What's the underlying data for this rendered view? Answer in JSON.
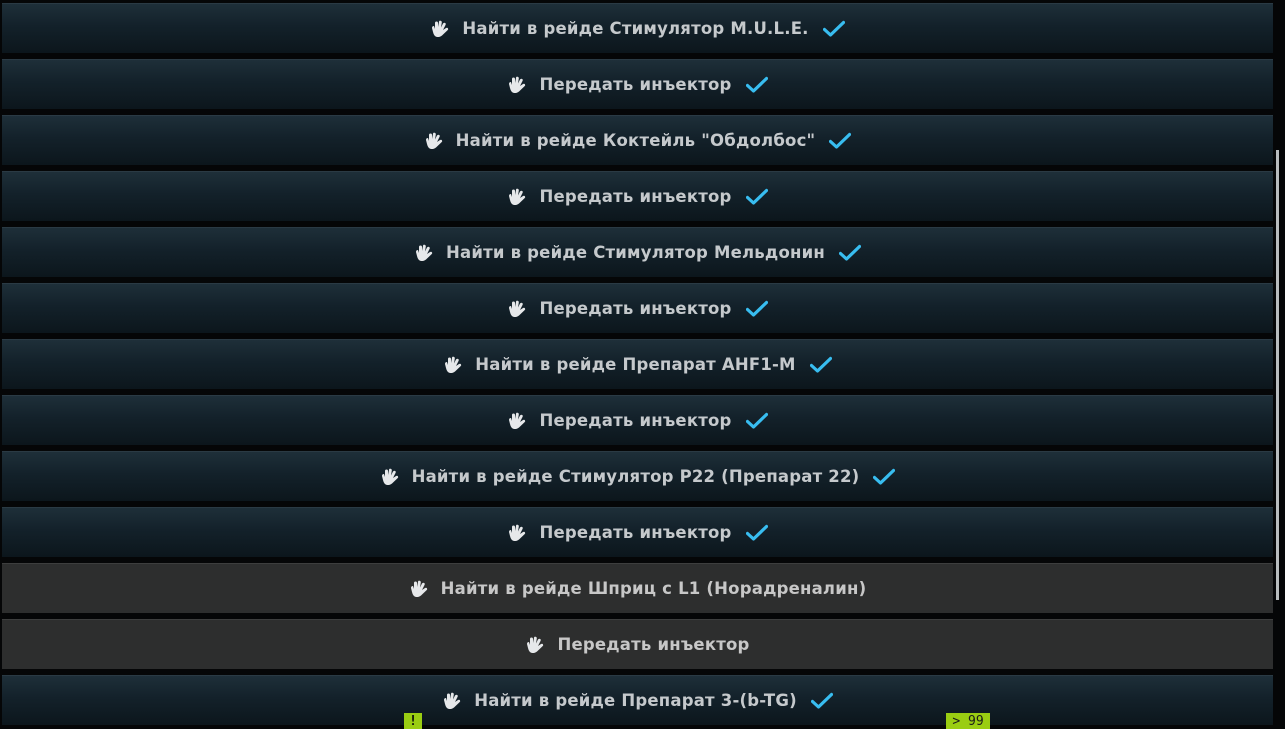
{
  "colors": {
    "done_row": "#13212a",
    "pending_row": "#2d2e2e",
    "check": "#38bdf0",
    "badge": "#9acd12"
  },
  "objectives": [
    {
      "label": "Найти в рейде Стимулятор M.U.L.E.",
      "icon": "hand-icon",
      "completed": true
    },
    {
      "label": "Передать инъектор",
      "icon": "hand-icon",
      "completed": true
    },
    {
      "label": "Найти в рейде Коктейль \"Обдолбос\"",
      "icon": "hand-icon",
      "completed": true
    },
    {
      "label": "Передать инъектор",
      "icon": "hand-icon",
      "completed": true
    },
    {
      "label": "Найти в рейде Стимулятор Мельдонин",
      "icon": "hand-icon",
      "completed": true
    },
    {
      "label": "Передать инъектор",
      "icon": "hand-icon",
      "completed": true
    },
    {
      "label": "Найти в рейде Препарат AHF1-M",
      "icon": "hand-icon",
      "completed": true
    },
    {
      "label": "Передать инъектор",
      "icon": "hand-icon",
      "completed": true
    },
    {
      "label": "Найти в рейде Стимулятор P22 (Препарат 22)",
      "icon": "hand-icon",
      "completed": true
    },
    {
      "label": "Передать инъектор",
      "icon": "hand-icon",
      "completed": true
    },
    {
      "label": "Найти в рейде Шприц с L1 (Норадреналин)",
      "icon": "hand-icon",
      "completed": false
    },
    {
      "label": "Передать инъектор",
      "icon": "hand-icon",
      "completed": false
    },
    {
      "label": "Найти в рейде Препарат 3-(b-TG)",
      "icon": "hand-icon",
      "completed": true
    }
  ],
  "badges": {
    "alert": "!",
    "count": "> 99"
  }
}
